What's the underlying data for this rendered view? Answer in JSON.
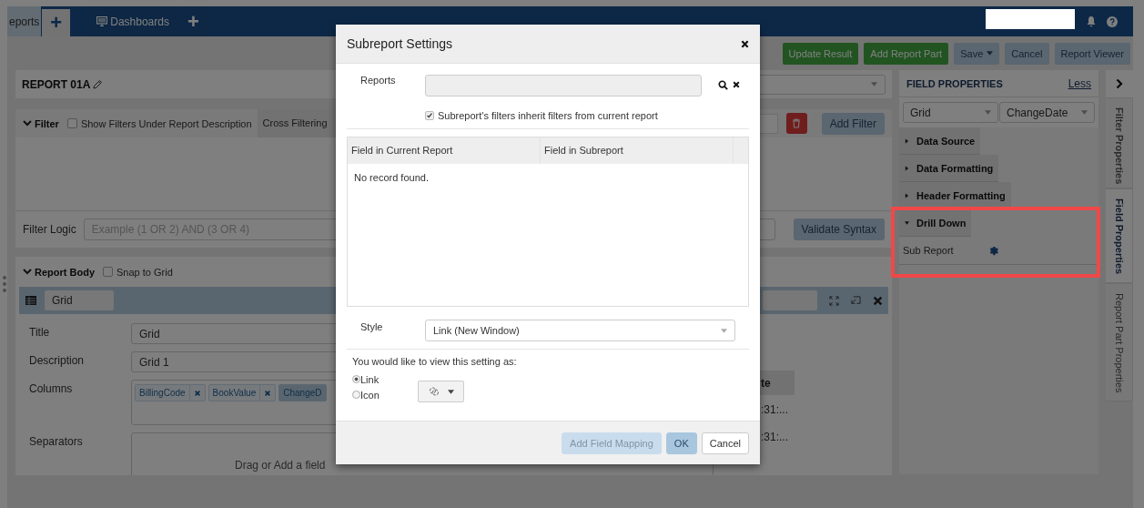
{
  "nav": {
    "tabs": [
      {
        "label": "eports",
        "kind": "text",
        "selected": false
      },
      {
        "label": "+",
        "kind": "add",
        "selected": true
      },
      {
        "label": "Dashboards",
        "kind": "dashboard",
        "selected": false
      },
      {
        "label": "+",
        "kind": "add",
        "selected": false
      }
    ]
  },
  "toolbar": {
    "buttons": [
      {
        "label": "Update Result",
        "kind": "success",
        "caret": false
      },
      {
        "label": "Add Report Part",
        "kind": "success",
        "caret": false
      },
      {
        "label": "Save",
        "kind": "default",
        "caret": true
      },
      {
        "label": "Cancel",
        "kind": "default",
        "caret": false
      },
      {
        "label": "Report Viewer",
        "kind": "default",
        "caret": false
      }
    ]
  },
  "report": {
    "title": "REPORT 01A"
  },
  "filter": {
    "label": "Filter",
    "expanded": true,
    "show_under_description": {
      "label": "Show Filters Under Report Description",
      "checked": false
    },
    "cross_filtering": "Cross Filtering",
    "add_button": "Add Filter",
    "logic_label": "Filter Logic",
    "logic_placeholder": "Example (1 OR 2) AND (3 OR 4)",
    "validate_button": "Validate Syntax"
  },
  "report_body": {
    "label": "Report Body",
    "expanded": true,
    "snap": {
      "label": "Snap to Grid",
      "checked": false
    },
    "part_name": "Grid",
    "fields": [
      {
        "label": "Title",
        "kind": "input",
        "value": "Grid"
      },
      {
        "label": "Description",
        "kind": "input",
        "value": "Grid 1"
      },
      {
        "label": "Columns",
        "kind": "tags",
        "tags": [
          {
            "label": "BillingCode",
            "selected": false
          },
          {
            "label": "BookValue",
            "selected": false
          },
          {
            "label": "ChangeD",
            "selected": true
          }
        ]
      },
      {
        "label": "Separators",
        "kind": "drop",
        "placeholder": "Drag or Add a field"
      }
    ],
    "preview": {
      "header": "te",
      "cells": [
        ":31:...",
        ":31:..."
      ]
    }
  },
  "field_properties": {
    "title": "FIELD PROPERTIES",
    "less_link": "Less",
    "selects": [
      "Grid",
      "ChangeDate"
    ],
    "sections": [
      {
        "label": "Data Source",
        "expanded": false,
        "highlighted": false
      },
      {
        "label": "Data Formatting",
        "expanded": false,
        "highlighted": false
      },
      {
        "label": "Header Formatting",
        "expanded": false,
        "highlighted": false
      },
      {
        "label": "Drill Down",
        "expanded": true,
        "highlighted": true,
        "items": [
          {
            "label": "Sub Report"
          }
        ]
      }
    ]
  },
  "side_tabs": [
    {
      "label": "Filter Properties",
      "selected": false
    },
    {
      "label": "Field Properties",
      "selected": true
    },
    {
      "label": "Report Part Properties",
      "selected": false
    }
  ],
  "modal": {
    "title": "Subreport Settings",
    "reports_label": "Reports",
    "inherit": {
      "label": "Subreport's filters inherit filters from current report",
      "checked": true
    },
    "columns": [
      "Field in Current Report",
      "Field in Subreport"
    ],
    "empty_text": "No record found.",
    "style_label": "Style",
    "style_value": "Link (New Window)",
    "view_prompt": "You would like to view this setting as:",
    "view_options": [
      {
        "label": "Link",
        "selected": true
      },
      {
        "label": "Icon",
        "selected": false
      }
    ],
    "buttons": [
      {
        "label": "Add Field Mapping",
        "kind": "primary",
        "disabled": true
      },
      {
        "label": "OK",
        "kind": "primary",
        "disabled": false
      },
      {
        "label": "Cancel",
        "kind": "default",
        "disabled": false
      }
    ]
  }
}
